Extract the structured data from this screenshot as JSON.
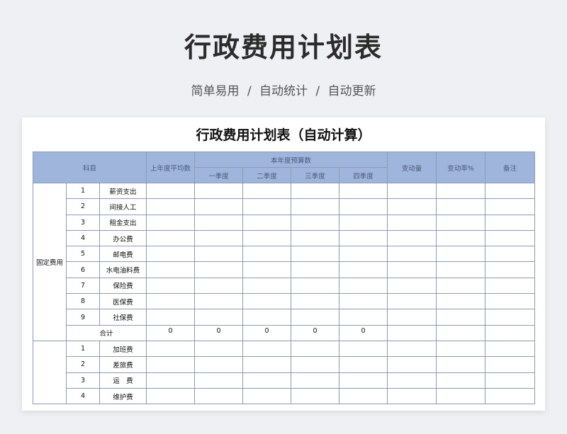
{
  "page": {
    "title": "行政费用计划表",
    "subtitle": "简单易用 / 自动统计 / 自动更新"
  },
  "sheet": {
    "title": "行政费用计划表（自动计算）",
    "headers": {
      "subject": "科目",
      "last_year_avg": "上年度平均数",
      "budget": "本年度预算数",
      "q1": "一季度",
      "q2": "二季度",
      "q3": "三季度",
      "q4": "四季度",
      "change": "变动量",
      "change_rate": "变动率%",
      "note": "备注"
    },
    "fixed": {
      "group": "固定费用",
      "items": [
        {
          "no": "1",
          "name": "薪资支出"
        },
        {
          "no": "2",
          "name": "间接人工"
        },
        {
          "no": "3",
          "name": "租金支出"
        },
        {
          "no": "4",
          "name": "办公费"
        },
        {
          "no": "5",
          "name": "邮电费"
        },
        {
          "no": "6",
          "name": "水电油料费"
        },
        {
          "no": "7",
          "name": "保险费"
        },
        {
          "no": "8",
          "name": "医保费"
        },
        {
          "no": "9",
          "name": "社保费"
        }
      ],
      "total_label": "合计",
      "totals": [
        "0",
        "0",
        "0",
        "0",
        "0"
      ]
    },
    "variable": {
      "items": [
        {
          "no": "1",
          "name": "加班费"
        },
        {
          "no": "2",
          "name": "差旅费"
        },
        {
          "no": "3",
          "name": "运　费"
        },
        {
          "no": "4",
          "name": "维护费"
        }
      ]
    }
  }
}
